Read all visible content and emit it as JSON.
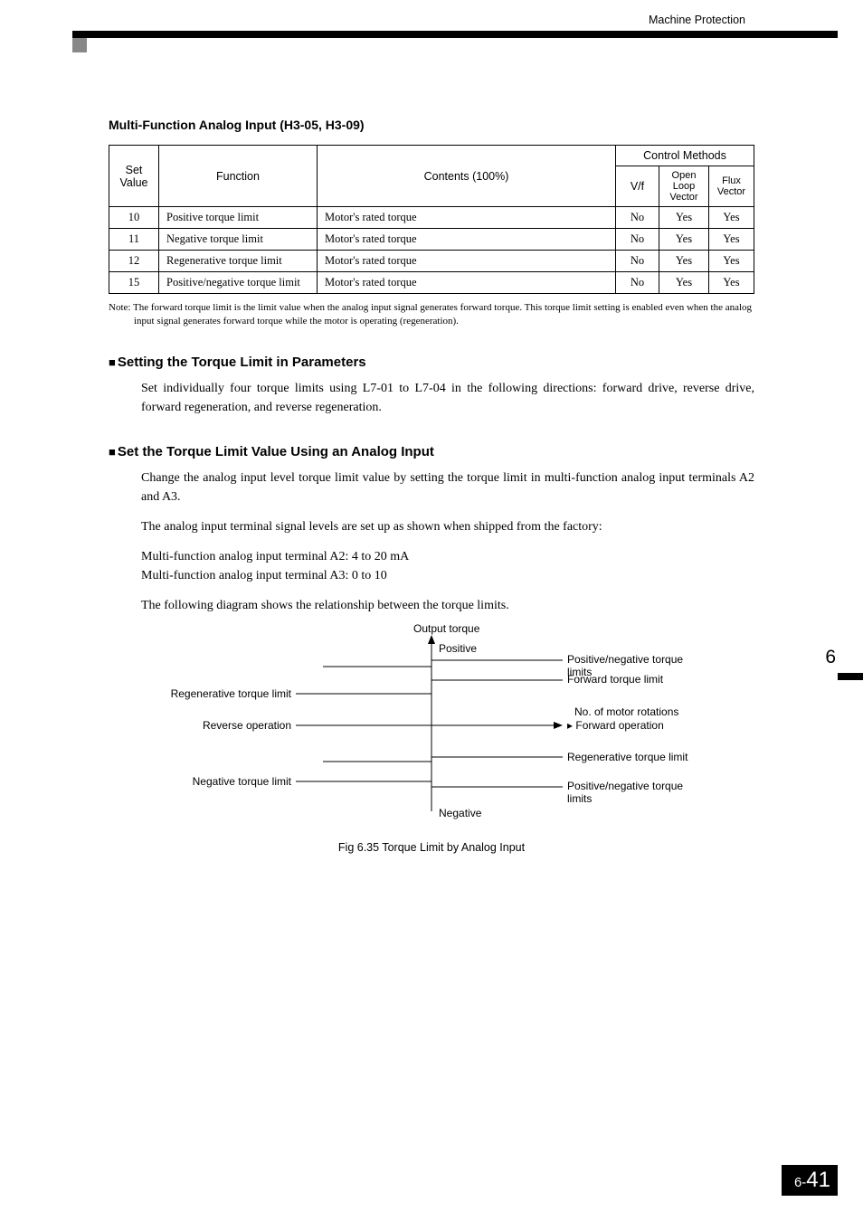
{
  "header": {
    "section": "Machine Protection"
  },
  "table_title": "Multi-Function Analog Input (H3-05, H3-09)",
  "table": {
    "headers": {
      "set_value": "Set Value",
      "function": "Function",
      "contents": "Contents (100%)",
      "control_methods": "Control Methods",
      "vf": "V/f",
      "olv": "Open Loop Vector",
      "fv": "Flux Vector"
    },
    "rows": [
      {
        "sv": "10",
        "fn": "Positive torque limit",
        "cn": "Motor's rated torque",
        "vf": "No",
        "olv": "Yes",
        "fv": "Yes"
      },
      {
        "sv": "11",
        "fn": "Negative torque limit",
        "cn": "Motor's rated torque",
        "vf": "No",
        "olv": "Yes",
        "fv": "Yes"
      },
      {
        "sv": "12",
        "fn": "Regenerative torque limit",
        "cn": "Motor's rated torque",
        "vf": "No",
        "olv": "Yes",
        "fv": "Yes"
      },
      {
        "sv": "15",
        "fn": "Positive/negative torque limit",
        "cn": "Motor's rated torque",
        "vf": "No",
        "olv": "Yes",
        "fv": "Yes"
      }
    ]
  },
  "table_note": "Note: The forward torque limit is the limit value when the analog input signal generates forward torque. This torque limit setting is enabled even when the analog input signal generates forward torque while the motor is operating (regeneration).",
  "sections": [
    {
      "title": "Setting the Torque Limit in Parameters",
      "paras": [
        "Set individually four torque limits using L7-01 to L7-04 in the following directions: forward drive, reverse drive, forward regeneration, and reverse regeneration."
      ]
    },
    {
      "title": "Set the Torque Limit Value Using an Analog Input",
      "paras": [
        "Change the analog input level torque limit value by setting the torque limit in multi-function analog input terminals A2 and A3.",
        "The analog input terminal signal levels are set up as shown when shipped from the factory:",
        "Multi-function analog input terminal A2: 4 to 20 mA\nMulti-function analog input terminal A3: 0 to 10",
        "The following diagram shows the relationship between the torque limits."
      ]
    }
  ],
  "diagram": {
    "output_torque": "Output torque",
    "positive": "Positive",
    "negative": "Negative",
    "pn_limits": "Positive/negative torque limits",
    "fwd_limit": "Forward torque limit",
    "regen_limit_left": "Regenerative torque limit",
    "regen_limit_right": "Regenerative torque limit",
    "neg_limit": "Negative torque limit",
    "rev_op": "Reverse operation",
    "fwd_op": "Forward operation",
    "rotations": "No. of motor rotations"
  },
  "figcap": "Fig 6.35  Torque Limit by Analog Input",
  "side_chapter": "6",
  "footer": {
    "chap": "6-",
    "page": "41"
  },
  "chart_data": {
    "type": "diagram",
    "title": "Torque Limit by Analog Input",
    "axes": {
      "y": "Output torque (Positive / Negative)",
      "x": "No. of motor rotations (Reverse / Forward)"
    },
    "quadrants": {
      "q1": [
        "Positive/negative torque limits",
        "Forward torque limit"
      ],
      "q2": [
        "Regenerative torque limit"
      ],
      "q3": [
        "Negative torque limit"
      ],
      "q4": [
        "Regenerative torque limit",
        "Positive/negative torque limits"
      ]
    }
  }
}
